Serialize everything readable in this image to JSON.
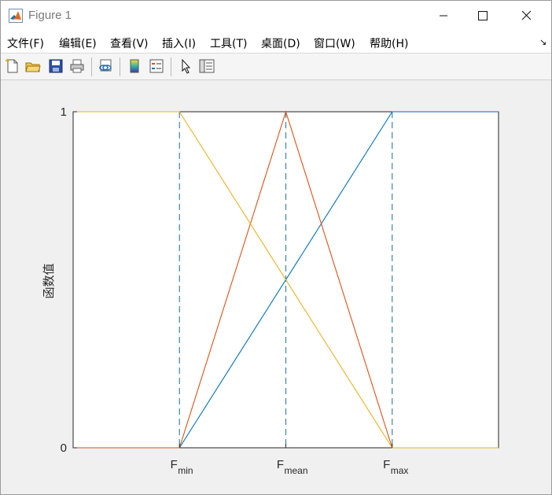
{
  "window": {
    "title": "Figure 1"
  },
  "menu": {
    "items": [
      {
        "label": "文件(F)",
        "name": "menu-file"
      },
      {
        "label": "编辑(E)",
        "name": "menu-edit"
      },
      {
        "label": "查看(V)",
        "name": "menu-view"
      },
      {
        "label": "插入(I)",
        "name": "menu-insert"
      },
      {
        "label": "工具(T)",
        "name": "menu-tools"
      },
      {
        "label": "桌面(D)",
        "name": "menu-desktop"
      },
      {
        "label": "窗口(W)",
        "name": "menu-window"
      },
      {
        "label": "帮助(H)",
        "name": "menu-help"
      }
    ],
    "expand_glyph": "↘"
  },
  "toolbar": {
    "icons": [
      "new-figure-icon",
      "open-folder-icon",
      "save-icon",
      "print-icon",
      "link-plot-icon",
      "insert-colorbar-icon",
      "insert-legend-icon",
      "edit-plot-arrow-icon",
      "property-inspector-icon"
    ]
  },
  "chart_data": {
    "type": "line",
    "ylabel": "函数值",
    "xlabel": "",
    "ylim": [
      0,
      1
    ],
    "xlim": [
      0,
      4
    ],
    "y_ticks": [
      "0",
      "1"
    ],
    "x_ticks": [
      {
        "x": 1,
        "base": "F",
        "sub": "min"
      },
      {
        "x": 2,
        "base": "F",
        "sub": "mean"
      },
      {
        "x": 3,
        "base": "F",
        "sub": "max"
      }
    ],
    "series": [
      {
        "color": "#0072bd",
        "points": [
          [
            0,
            0
          ],
          [
            1,
            0
          ],
          [
            3,
            1
          ],
          [
            4,
            1
          ]
        ]
      },
      {
        "color": "#d95319",
        "points": [
          [
            0,
            0
          ],
          [
            1,
            0
          ],
          [
            2,
            1
          ],
          [
            3,
            0
          ],
          [
            4,
            0
          ]
        ]
      },
      {
        "color": "#edb120",
        "points": [
          [
            0,
            1
          ],
          [
            1,
            1
          ],
          [
            3,
            0
          ],
          [
            4,
            0
          ]
        ]
      }
    ],
    "reference_lines": {
      "x": [
        1,
        2,
        3
      ],
      "color": "#3d87a6",
      "style": "dashed"
    },
    "grid": false,
    "legend": "none"
  }
}
